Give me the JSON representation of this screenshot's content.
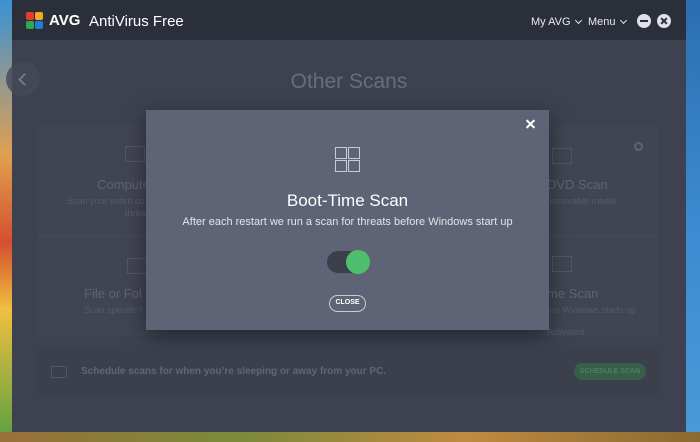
{
  "app": {
    "brand": "AVG",
    "name": "AntiVirus Free",
    "nav": [
      "My AVG",
      "Menu"
    ],
    "logo_colors": [
      "#e63b2e",
      "#f5a623",
      "#2fa84f",
      "#1c7ed6"
    ]
  },
  "page": {
    "title": "Other Scans"
  },
  "tiles": [
    {
      "title": "Compute",
      "desc_line1": "Scan your entire co",
      "desc_line2": "threa"
    },
    {
      "title": "DVD Scan",
      "desc": "removable media"
    },
    {
      "title": "File or Fol",
      "desc": "Scan specific f"
    },
    {
      "title": "me Scan",
      "desc": "ore Windows starts up",
      "status": "Activated"
    }
  ],
  "schedule": {
    "text": "Schedule scans for when you’re sleeping or away from your PC.",
    "button": "SCHEDULE SCAN"
  },
  "modal": {
    "title": "Boot-Time Scan",
    "description": "After each restart we run a scan for threats before Windows start up",
    "toggle_on": true,
    "close_label": "CLOSE"
  },
  "icons": {
    "logo": "avg-logo",
    "windows": "windows-icon",
    "gear": "gear-icon",
    "back": "back-arrow-icon"
  },
  "colors": {
    "accent": "#4fbf6d",
    "titlebar": "#2b2f39",
    "modal": "#5e6475"
  }
}
